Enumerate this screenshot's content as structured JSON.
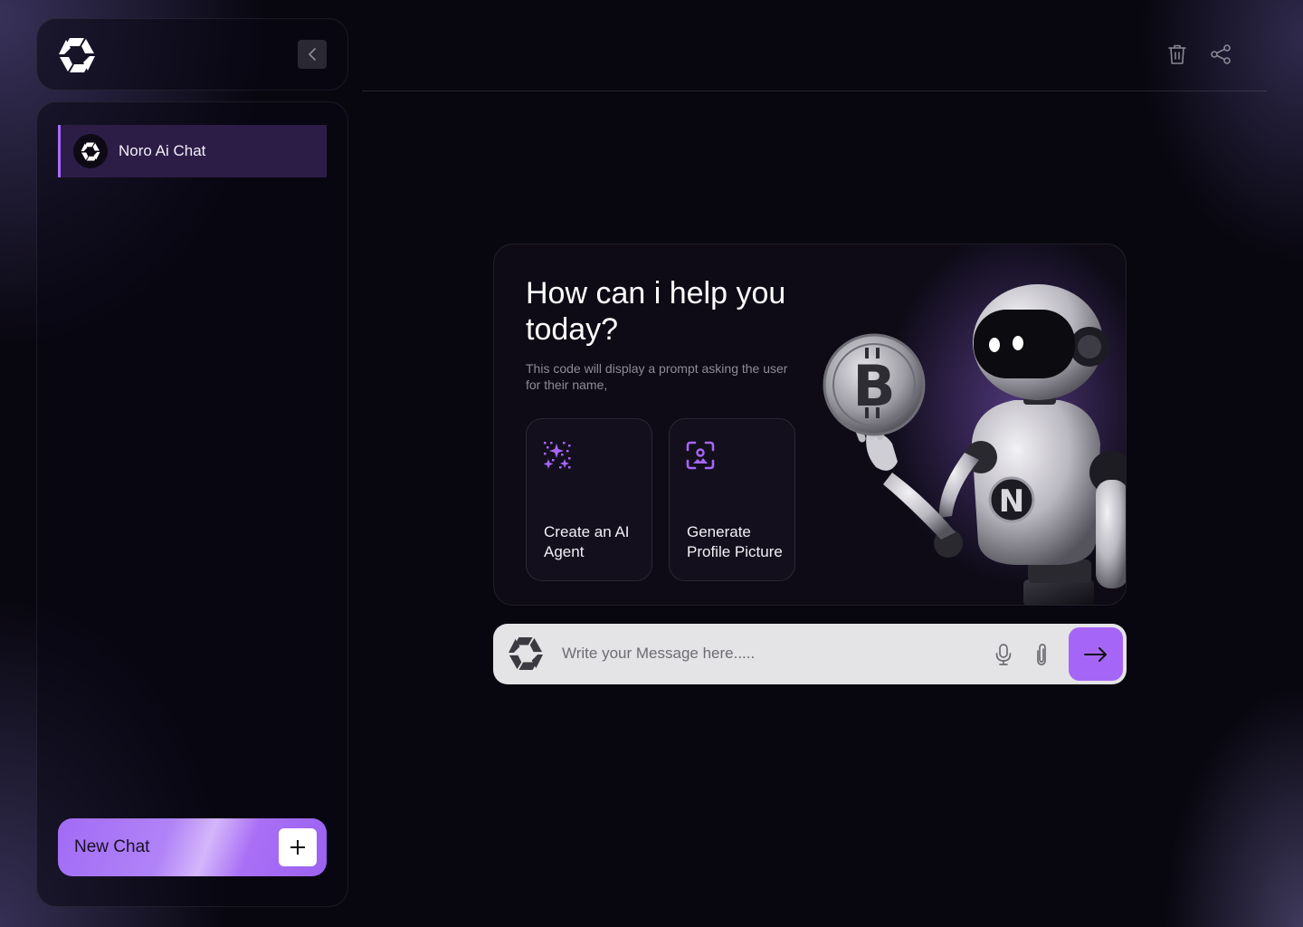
{
  "app": {
    "logo_icon": "hexagon-shutter-logo-icon",
    "accent_color": "#a566f7"
  },
  "sidebar": {
    "collapse_icon": "chevron-left-icon",
    "chats": [
      {
        "label": "Noro Ai Chat",
        "active": true
      }
    ],
    "new_chat": {
      "label": "New Chat",
      "icon": "plus-icon"
    }
  },
  "toolbar": {
    "delete_icon": "trash-icon",
    "share_icon": "share-icon"
  },
  "hero": {
    "title": "How can i help you today?",
    "subtitle": "This code will display a prompt asking the user for their name,",
    "cards": [
      {
        "label": "Create an AI Agent",
        "icon": "sparkles-grid-icon"
      },
      {
        "label": "Generate Profile Picture",
        "icon": "profile-picture-icon"
      }
    ],
    "illustration": "robot-holding-bitcoin-illustration"
  },
  "composer": {
    "placeholder": "Write your Message here.....",
    "mic_icon": "microphone-icon",
    "attach_icon": "paperclip-icon",
    "send_icon": "arrow-right-icon"
  }
}
